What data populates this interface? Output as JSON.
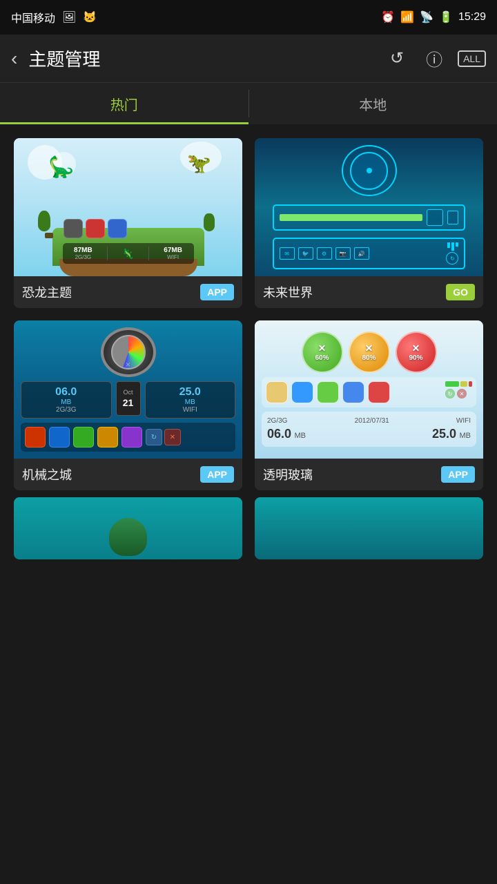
{
  "statusBar": {
    "carrier": "中国移动",
    "time": "15:29"
  },
  "titleBar": {
    "title": "主题管理",
    "backLabel": "‹",
    "refreshLabel": "↺",
    "infoLabel": "ⓘ",
    "allLabel": "ALL"
  },
  "tabs": [
    {
      "id": "hot",
      "label": "热门",
      "active": true
    },
    {
      "id": "local",
      "label": "本地",
      "active": false
    }
  ],
  "themes": [
    {
      "id": "dino",
      "name": "恐龙主题",
      "badge": "APP",
      "badgeType": "app"
    },
    {
      "id": "future",
      "name": "未来世界",
      "badge": "GO",
      "badgeType": "go"
    },
    {
      "id": "mech",
      "name": "机械之城",
      "badge": "APP",
      "badgeType": "app"
    },
    {
      "id": "glass",
      "name": "透明玻璃",
      "badge": "APP",
      "badgeType": "app"
    }
  ],
  "mechWidget": {
    "num1": "06.0",
    "unit1": "MB",
    "label1": "2G/3G",
    "num2": "25.0",
    "unit2": "MB",
    "label2": "WIFI"
  },
  "glassWidget": {
    "label1": "2G/3G",
    "label2": "2012/07/31",
    "label3": "WIFI",
    "num1": "06.0",
    "unit1": "MB",
    "num2": "25.0",
    "unit2": "MB",
    "pct1": "60%",
    "pct2": "80%",
    "pct3": "90%"
  }
}
